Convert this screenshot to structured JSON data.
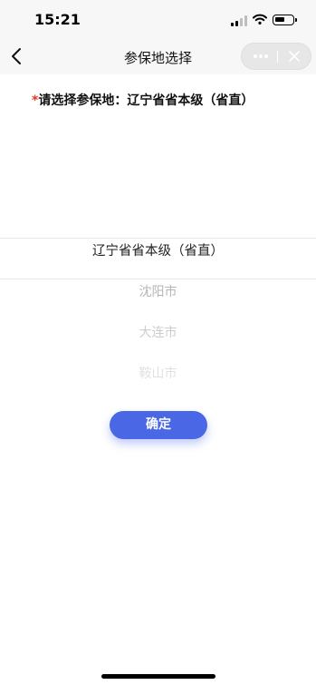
{
  "status_bar": {
    "time": "15:21"
  },
  "nav": {
    "title": "参保地选择"
  },
  "prompt": {
    "required_mark": "*",
    "label": "请选择参保地：",
    "selected_value": "辽宁省省本级（省直）"
  },
  "picker": {
    "options": [
      "辽宁省省本级（省直）",
      "沈阳市",
      "大连市",
      "鞍山市"
    ],
    "selected_index": 0
  },
  "confirm_button": {
    "label": "确定"
  },
  "colors": {
    "primary": "#4a68e6",
    "required": "#e5332a"
  }
}
